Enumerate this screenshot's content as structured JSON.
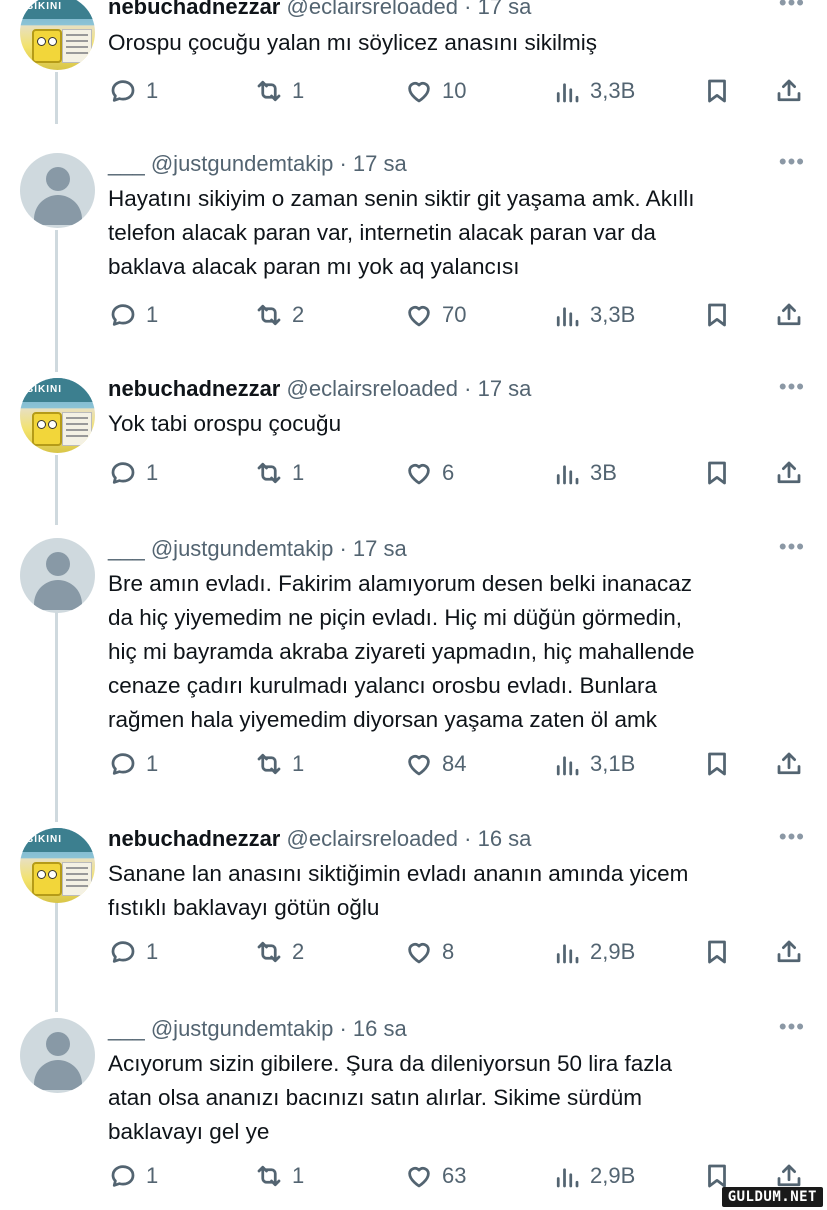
{
  "tweets": [
    {
      "author": "sponge",
      "name": "nebuchadnezzar",
      "handle_time": "@eclairsreloaded · 17 sa",
      "text_lines": [
        "Orospu çocuğu yalan mı söylicez anasını sikilmiş"
      ],
      "replies": "1",
      "retweets": "1",
      "likes": "10",
      "views": "3,3B"
    },
    {
      "author": "default",
      "name": "___",
      "handle_time": "@justgundemtakip · 17 sa",
      "text_lines": [
        "Hayatını sikiyim o zaman senin siktir git yaşama amk. Akıllı",
        "telefon alacak paran var, internetin alacak paran var da",
        "baklava alacak paran mı yok aq yalancısı"
      ],
      "replies": "1",
      "retweets": "2",
      "likes": "70",
      "views": "3,3B"
    },
    {
      "author": "sponge",
      "name": "nebuchadnezzar",
      "handle_time": "@eclairsreloaded · 17 sa",
      "text_lines": [
        "Yok tabi orospu çocuğu"
      ],
      "replies": "1",
      "retweets": "1",
      "likes": "6",
      "views": "3B"
    },
    {
      "author": "default",
      "name": "___",
      "handle_time": "@justgundemtakip · 17 sa",
      "text_lines": [
        "Bre amın evladı. Fakirim alamıyorum desen belki inanacaz",
        "da hiç yiyemedim ne piçin evladı. Hiç mi düğün görmedin,",
        "hiç mi bayramda akraba ziyareti yapmadın, hiç mahallende",
        "cenaze çadırı kurulmadı yalancı orosbu evladı. Bunlara",
        "rağmen hala yiyemedim diyorsan yaşama zaten öl amk"
      ],
      "replies": "1",
      "retweets": "1",
      "likes": "84",
      "views": "3,1B"
    },
    {
      "author": "sponge",
      "name": "nebuchadnezzar",
      "handle_time": "@eclairsreloaded · 16 sa",
      "text_lines": [
        "Sanane lan anasını siktiğimin evladı ananın amında yicem",
        "fıstıklı baklavayı götün oğlu"
      ],
      "replies": "1",
      "retweets": "2",
      "likes": "8",
      "views": "2,9B"
    },
    {
      "author": "default",
      "name": "___",
      "handle_time": "@justgundemtakip · 16 sa",
      "text_lines": [
        "Acıyorum sizin gibilere. Şura da dileniyorsun 50 lira fazla",
        "atan olsa ananızı bacınızı satın alırlar. Sikime sürdüm",
        "baklavayı gel ye"
      ],
      "replies": "1",
      "retweets": "1",
      "likes": "63",
      "views": "2,9B"
    }
  ],
  "more_glyph": "•••",
  "avatar_logo_text": "BIKINI",
  "watermark": "GULDUM.NET"
}
